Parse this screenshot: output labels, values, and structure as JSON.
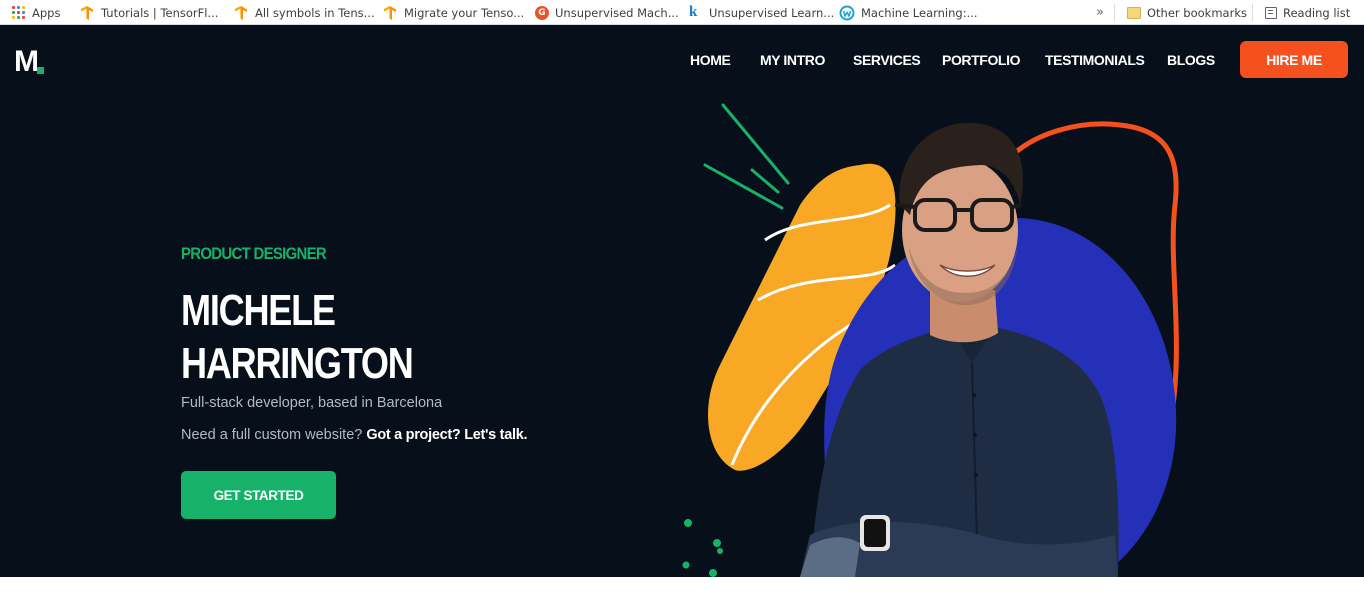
{
  "bookmarks_bar": {
    "items": [
      {
        "label": "Apps",
        "icon": "apps-grid-icon"
      },
      {
        "label": "Tutorials  |  TensorFl...",
        "icon": "tensorflow-icon"
      },
      {
        "label": "All symbols in Tens...",
        "icon": "tensorflow-icon"
      },
      {
        "label": "Migrate your Tenso...",
        "icon": "tensorflow-icon"
      },
      {
        "label": "Unsupervised Mach...",
        "icon": "g-site-icon"
      },
      {
        "label": "Unsupervised Learn...",
        "icon": "k-site-icon"
      },
      {
        "label": "Machine Learning:...",
        "icon": "w-site-icon"
      }
    ],
    "overflow": "»",
    "other_bookmarks": "Other bookmarks",
    "reading_list": "Reading list"
  },
  "header": {
    "logo_text": "M",
    "nav": [
      "HOME",
      "MY INTRO",
      "SERVICES",
      "PORTFOLIO",
      "TESTIMONIALS",
      "BLOGS"
    ],
    "hire_button": "HIRE ME"
  },
  "hero": {
    "subtitle": "PRODUCT DESIGNER",
    "name_line1": "MICHELE",
    "name_line2": "HARRINGTON",
    "description": "Full-stack developer, based in Barcelona",
    "cta_prefix": "Need a full custom website? ",
    "cta_link": "Got a project? Let's talk.",
    "button": "GET STARTED"
  },
  "colors": {
    "background": "#07101a",
    "accent_green": "#17b26a",
    "accent_orange": "#f4511e",
    "blob_yellow": "#f9a825",
    "blob_blue": "#2530b8"
  }
}
